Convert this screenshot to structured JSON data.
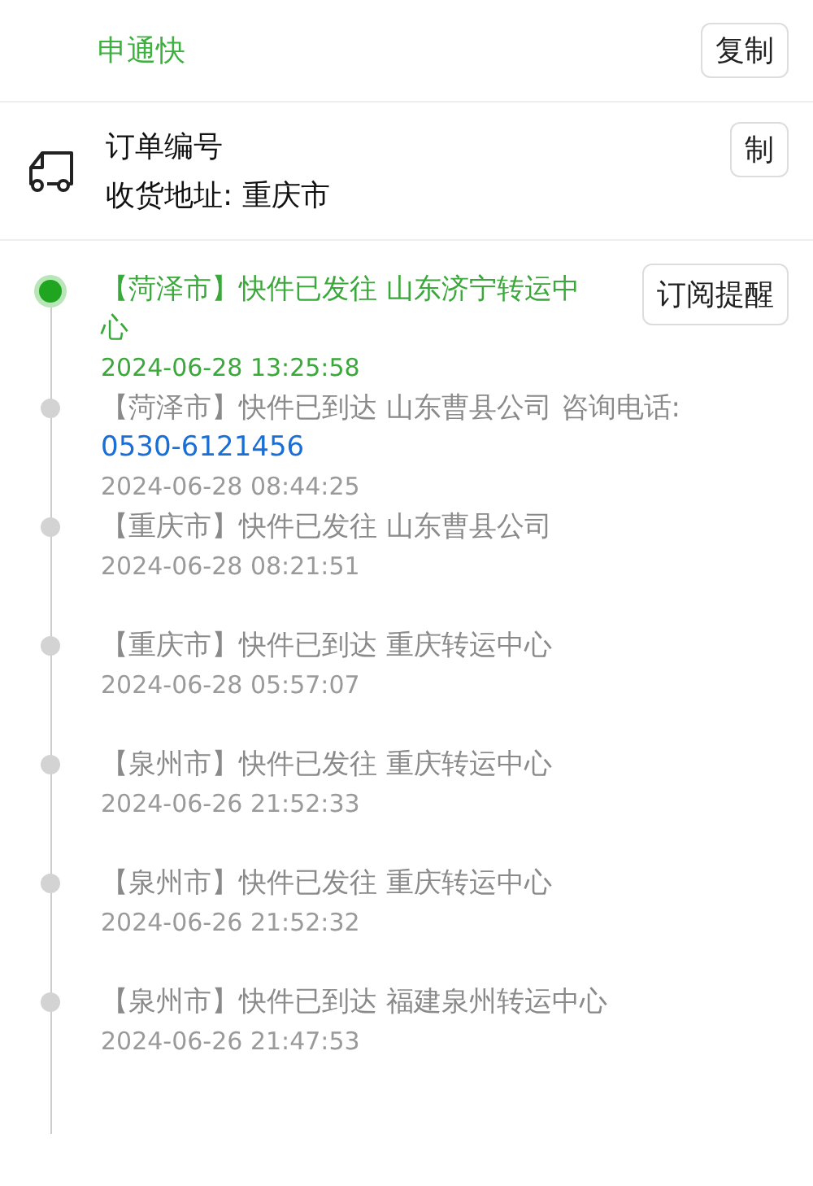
{
  "carrier": {
    "name": "申通快",
    "copy_button": "复制"
  },
  "order": {
    "number_label": "订单编号",
    "copy_button": "制",
    "address": "收货地址: 重庆市"
  },
  "subscribe_button": "订阅提醒",
  "events": [
    {
      "text": "【菏泽市】快件已发往 山东济宁转运中心",
      "time": "2024-06-28 13:25:58",
      "selected": true
    },
    {
      "text": "【菏泽市】快件已到达 山东曹县公司 咨询电话:",
      "phone": "0530-6121456",
      "time": "2024-06-28 08:44:25",
      "selected": false
    },
    {
      "text": "【重庆市】快件已发往 山东曹县公司",
      "time": "2024-06-28 08:21:51",
      "selected": false
    },
    {
      "text": "【重庆市】快件已到达 重庆转运中心",
      "time": "2024-06-28 05:57:07",
      "selected": false
    },
    {
      "text": "【泉州市】快件已发往 重庆转运中心",
      "time": "2024-06-26 21:52:33",
      "selected": false
    },
    {
      "text": "【泉州市】快件已发往 重庆转运中心",
      "time": "2024-06-26 21:52:32",
      "selected": false
    },
    {
      "text": "【泉州市】快件已到达 福建泉州转运中心",
      "time": "2024-06-26 21:47:53",
      "selected": false
    }
  ]
}
